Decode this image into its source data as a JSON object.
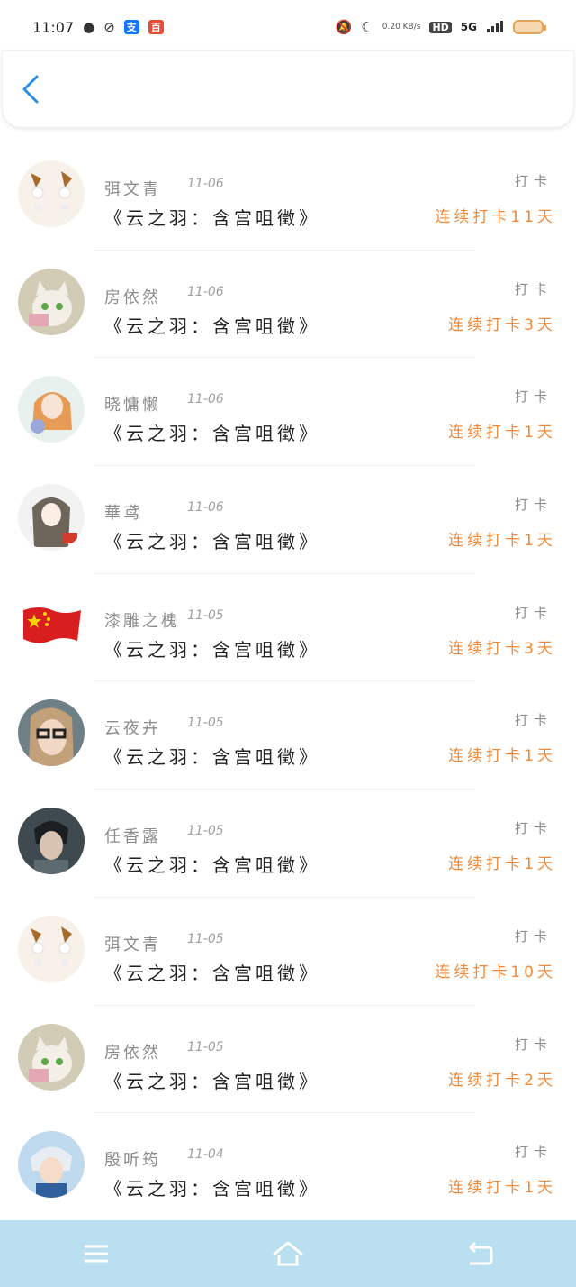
{
  "status": {
    "time": "11:07",
    "net_speed": "0.20 KB/s",
    "hd": "HD",
    "signal": "5G"
  },
  "header": {
    "back_label": "‹"
  },
  "rows": [
    {
      "name": "弭文青",
      "date": "11-06",
      "title": "《云之羽：含宫咀徵》",
      "label": "打卡",
      "streak": "连续打卡11天",
      "avatar": "earring"
    },
    {
      "name": "房依然",
      "date": "11-06",
      "title": "《云之羽：含宫咀徵》",
      "label": "打卡",
      "streak": "连续打卡3天",
      "avatar": "cat"
    },
    {
      "name": "晓慵懒",
      "date": "11-06",
      "title": "《云之羽：含宫咀徵》",
      "label": "打卡",
      "streak": "连续打卡1天",
      "avatar": "girl"
    },
    {
      "name": "華鸢",
      "date": "11-06",
      "title": "《云之羽：含宫咀徵》",
      "label": "打卡",
      "streak": "连续打卡1天",
      "avatar": "anime"
    },
    {
      "name": "漆雕之槐",
      "date": "11-05",
      "title": "《云之羽：含宫咀徵》",
      "label": "打卡",
      "streak": "连续打卡3天",
      "avatar": "flag"
    },
    {
      "name": "云夜卉",
      "date": "11-05",
      "title": "《云之羽：含宫咀徵》",
      "label": "打卡",
      "streak": "连续打卡1天",
      "avatar": "glasses"
    },
    {
      "name": "任香露",
      "date": "11-05",
      "title": "《云之羽：含宫咀徵》",
      "label": "打卡",
      "streak": "连续打卡1天",
      "avatar": "man"
    },
    {
      "name": "弭文青",
      "date": "11-05",
      "title": "《云之羽：含宫咀徵》",
      "label": "打卡",
      "streak": "连续打卡10天",
      "avatar": "earring"
    },
    {
      "name": "房依然",
      "date": "11-05",
      "title": "《云之羽：含宫咀徵》",
      "label": "打卡",
      "streak": "连续打卡2天",
      "avatar": "cat"
    },
    {
      "name": "殷听筠",
      "date": "11-04",
      "title": "《云之羽：含宫咀徵》",
      "label": "打卡",
      "streak": "连续打卡1天",
      "avatar": "silver"
    }
  ],
  "colors": {
    "accent_back": "#2b8fe6",
    "streak": "#f08a3a",
    "navbar": "#b9dff1"
  },
  "navbar": {
    "items": [
      "menu-icon",
      "home-icon",
      "back-icon"
    ]
  }
}
